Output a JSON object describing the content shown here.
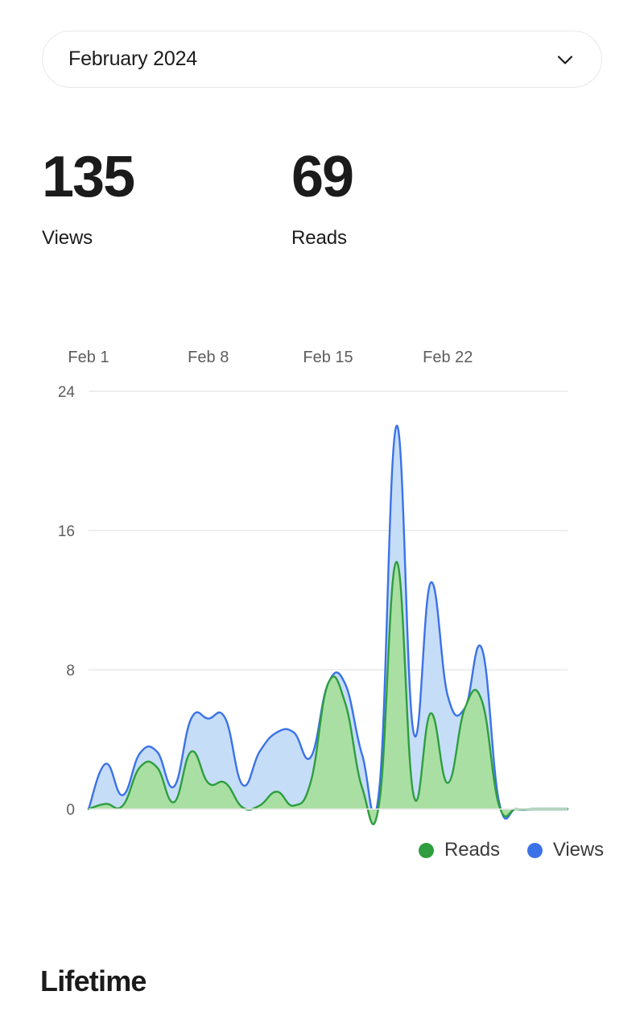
{
  "month_selector": {
    "value": "February 2024",
    "chevron_icon": "chevron-down-icon"
  },
  "stats": [
    {
      "value": "135",
      "label": "Views"
    },
    {
      "value": "69",
      "label": "Reads"
    }
  ],
  "legend": [
    {
      "label": "Reads",
      "color": "#2e9e3e",
      "icon": "dot-icon"
    },
    {
      "label": "Views",
      "color": "#3b72e8",
      "icon": "dot-icon"
    }
  ],
  "section_heading": "Lifetime",
  "colors": {
    "views_stroke": "#3b72e8",
    "views_fill": "#c6ddf7",
    "reads_stroke": "#2e9e3e",
    "reads_fill": "#aadfa3",
    "gridline": "#e9e9e9",
    "tick_text": "#5d5d5d"
  },
  "chart_data": {
    "type": "area",
    "title": "",
    "xlabel": "",
    "ylabel": "",
    "grid": true,
    "legend_position": "bottom-right",
    "ylim": [
      0,
      24
    ],
    "yticks": [
      0,
      8,
      16,
      24
    ],
    "x": [
      "Feb 1",
      "Feb 2",
      "Feb 3",
      "Feb 4",
      "Feb 5",
      "Feb 6",
      "Feb 7",
      "Feb 8",
      "Feb 9",
      "Feb 10",
      "Feb 11",
      "Feb 12",
      "Feb 13",
      "Feb 14",
      "Feb 15",
      "Feb 16",
      "Feb 17",
      "Feb 18",
      "Feb 19",
      "Feb 20",
      "Feb 21",
      "Feb 22",
      "Feb 23",
      "Feb 24",
      "Feb 25",
      "Feb 26",
      "Feb 27",
      "Feb 28",
      "Feb 29"
    ],
    "xticks": [
      "Feb 1",
      "Feb 8",
      "Feb 15",
      "Feb 22"
    ],
    "xtick_indices": [
      0,
      7,
      14,
      21
    ],
    "series": [
      {
        "name": "Views",
        "color": "#3b72e8",
        "fill": "#c6ddf7",
        "values": [
          0,
          2.6,
          0.8,
          3.2,
          3.3,
          1.3,
          5.2,
          5.2,
          5.2,
          1.4,
          3.3,
          4.4,
          4.4,
          3.0,
          7.2,
          7.2,
          3.1,
          1.2,
          22.0,
          4.4,
          13.0,
          6.5,
          5.8,
          9.2,
          0.4,
          0,
          0,
          0,
          0
        ]
      },
      {
        "name": "Reads",
        "color": "#2e9e3e",
        "fill": "#aadfa3",
        "values": [
          0,
          0.3,
          0.2,
          2.4,
          2.4,
          0.4,
          3.3,
          1.5,
          1.5,
          0.1,
          0.2,
          1.0,
          0.2,
          1.6,
          7.2,
          6.1,
          1.2,
          0.4,
          14.2,
          0.8,
          5.5,
          1.5,
          5.8,
          6.2,
          0.2,
          0,
          0,
          0,
          0
        ]
      }
    ]
  }
}
